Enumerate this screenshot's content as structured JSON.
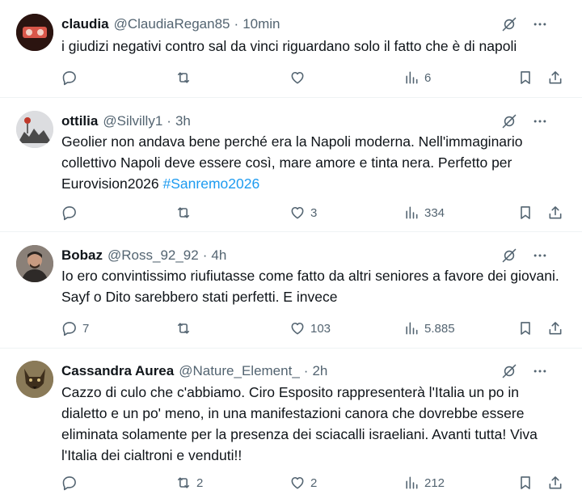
{
  "tweets": [
    {
      "name": "claudia",
      "handle": "@ClaudiaRegan85",
      "time": "10min",
      "text": "i giudizi negativi contro sal da vinci riguardano solo il fatto che è di napoli",
      "hashtag": "",
      "replies": "",
      "retweets": "",
      "likes": "",
      "views": "6",
      "avatar_colors": [
        "#2b1410",
        "#c8473a"
      ]
    },
    {
      "name": "ottilia",
      "handle": "@Silvilly1",
      "time": "3h",
      "text": "Geolier non andava bene perché era la Napoli moderna. Nell'immaginario collettivo Napoli deve essere così, mare amore e tinta nera. Perfetto per Eurovision2026",
      "hashtag": "#Sanremo2026",
      "replies": "",
      "retweets": "",
      "likes": "3",
      "views": "334",
      "avatar_colors": [
        "#d9dadc",
        "#4a4a4a"
      ]
    },
    {
      "name": "Bobaz",
      "handle": "@Ross_92_92",
      "time": "4h",
      "text": "Io ero convintissimo riufiutasse come fatto da altri seniores a favore dei giovani. Sayf o Dito sarebbero stati perfetti. E invece",
      "hashtag": "",
      "replies": "7",
      "retweets": "",
      "likes": "103",
      "views": "5.885",
      "avatar_colors": [
        "#6d6560",
        "#2e2a28"
      ]
    },
    {
      "name": "Cassandra Aurea",
      "handle": "@Nature_Element_",
      "time": "2h",
      "text": "Cazzo di culo che c'abbiamo. Ciro Esposito rappresenterà l'Italia un po in dialetto e un po' meno, in una manifestazioni canora che dovrebbe essere eliminata solamente per la presenza dei sciacalli israeliani. Avanti tutta! Viva l'Italia dei cialtroni e venduti!!",
      "hashtag": "",
      "replies": "",
      "retweets": "2",
      "likes": "2",
      "views": "212",
      "avatar_colors": [
        "#7a6a4a",
        "#3d3020"
      ]
    }
  ]
}
